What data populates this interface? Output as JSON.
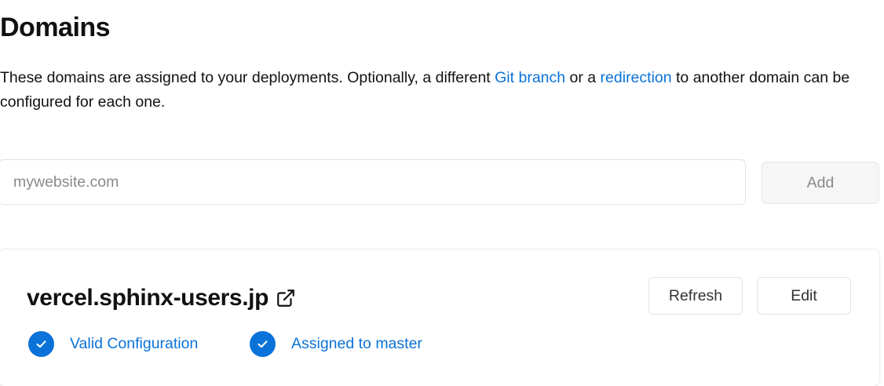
{
  "header": {
    "title": "Domains"
  },
  "description": {
    "part1": "These domains are assigned to your deployments. Optionally, a different ",
    "git_branch_link": "Git branch",
    "part2": " or a ",
    "redirection_link": "redirection",
    "part3": " to another domain can be configured for each one."
  },
  "add_form": {
    "placeholder": "mywebsite.com",
    "value": "",
    "add_label": "Add"
  },
  "domain_card": {
    "domain": "vercel.sphinx-users.jp",
    "external_icon": "external-link-icon",
    "refresh_label": "Refresh",
    "edit_label": "Edit",
    "statuses": [
      {
        "icon": "check-circle-icon",
        "label": "Valid Configuration"
      },
      {
        "icon": "check-circle-icon",
        "label": "Assigned to master"
      }
    ]
  },
  "colors": {
    "link": "#0a72d8",
    "text": "#111111",
    "muted": "#8a8a8a",
    "border": "#e3e3e3"
  }
}
